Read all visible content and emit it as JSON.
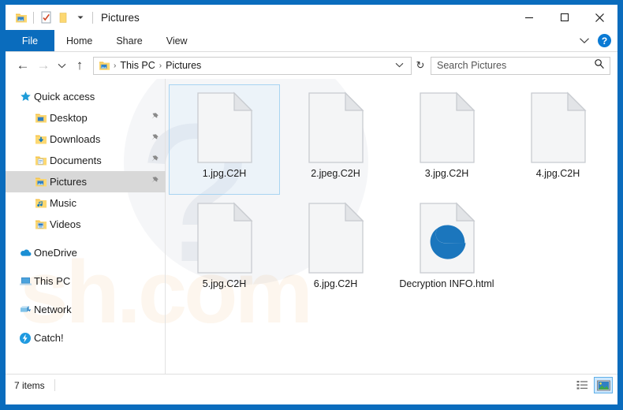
{
  "window": {
    "title": "Pictures",
    "frame_color": "#0a6cbd",
    "accent_color": "#0a6cbd",
    "quick_access_toolbar": [
      {
        "name": "pictures-folder-icon",
        "label": "Pictures folder"
      },
      {
        "name": "properties-icon",
        "label": "Properties"
      },
      {
        "name": "new-folder-icon",
        "label": "New folder"
      },
      {
        "name": "customize-qat-dropdown-icon",
        "label": "Customize Quick Access Toolbar"
      }
    ],
    "caption_buttons": {
      "minimize": "—",
      "maximize": "☐",
      "close": "✕"
    }
  },
  "ribbon": {
    "file_tab": "File",
    "tabs": [
      {
        "label": "Home"
      },
      {
        "label": "Share"
      },
      {
        "label": "View"
      }
    ],
    "expand_chevron": "⌄",
    "help_label": "?"
  },
  "address": {
    "back_arrow": "←",
    "forward_arrow": "→",
    "recent_chevron": "⌄",
    "up_arrow": "↑",
    "breadcrumbs": [
      {
        "label": "This PC"
      },
      {
        "label": "Pictures"
      }
    ],
    "separator": "›",
    "dropdown_chevron": "⌄",
    "refresh_glyph": "↻"
  },
  "search": {
    "placeholder": "Search Pictures",
    "icon": "search-icon"
  },
  "sidebar": {
    "groups": [
      {
        "header": {
          "label": "Quick access",
          "icon": "star-icon"
        },
        "items": [
          {
            "label": "Desktop",
            "icon": "folder-desktop-icon",
            "pinned": true,
            "selected": false
          },
          {
            "label": "Downloads",
            "icon": "folder-downloads-icon",
            "pinned": true,
            "selected": false
          },
          {
            "label": "Documents",
            "icon": "folder-documents-icon",
            "pinned": true,
            "selected": false
          },
          {
            "label": "Pictures",
            "icon": "folder-pictures-icon",
            "pinned": true,
            "selected": true
          },
          {
            "label": "Music",
            "icon": "folder-music-icon",
            "pinned": false,
            "selected": false
          },
          {
            "label": "Videos",
            "icon": "folder-videos-icon",
            "pinned": false,
            "selected": false
          }
        ]
      },
      {
        "header": {
          "label": "OneDrive",
          "icon": "onedrive-cloud-icon"
        },
        "items": []
      },
      {
        "header": {
          "label": "This PC",
          "icon": "this-pc-icon"
        },
        "items": []
      },
      {
        "header": {
          "label": "Network",
          "icon": "network-icon"
        },
        "items": []
      },
      {
        "header": {
          "label": "Catch!",
          "icon": "catch-lightning-icon"
        },
        "items": []
      }
    ]
  },
  "files": [
    {
      "name": "1.jpg.C2H",
      "icon": "blank-document-icon",
      "selected": true
    },
    {
      "name": "2.jpeg.C2H",
      "icon": "blank-document-icon",
      "selected": false
    },
    {
      "name": "3.jpg.C2H",
      "icon": "blank-document-icon",
      "selected": false
    },
    {
      "name": "4.jpg.C2H",
      "icon": "blank-document-icon",
      "selected": false
    },
    {
      "name": "5.jpg.C2H",
      "icon": "blank-document-icon",
      "selected": false
    },
    {
      "name": "6.jpg.C2H",
      "icon": "blank-document-icon",
      "selected": false
    },
    {
      "name": "Decryption INFO.html",
      "icon": "edge-html-document-icon",
      "selected": false
    }
  ],
  "status": {
    "item_count": "7 items",
    "views": [
      {
        "name": "details-view",
        "active": false
      },
      {
        "name": "large-icons-view",
        "active": true
      }
    ]
  },
  "watermark": {
    "text": "sh.com"
  }
}
